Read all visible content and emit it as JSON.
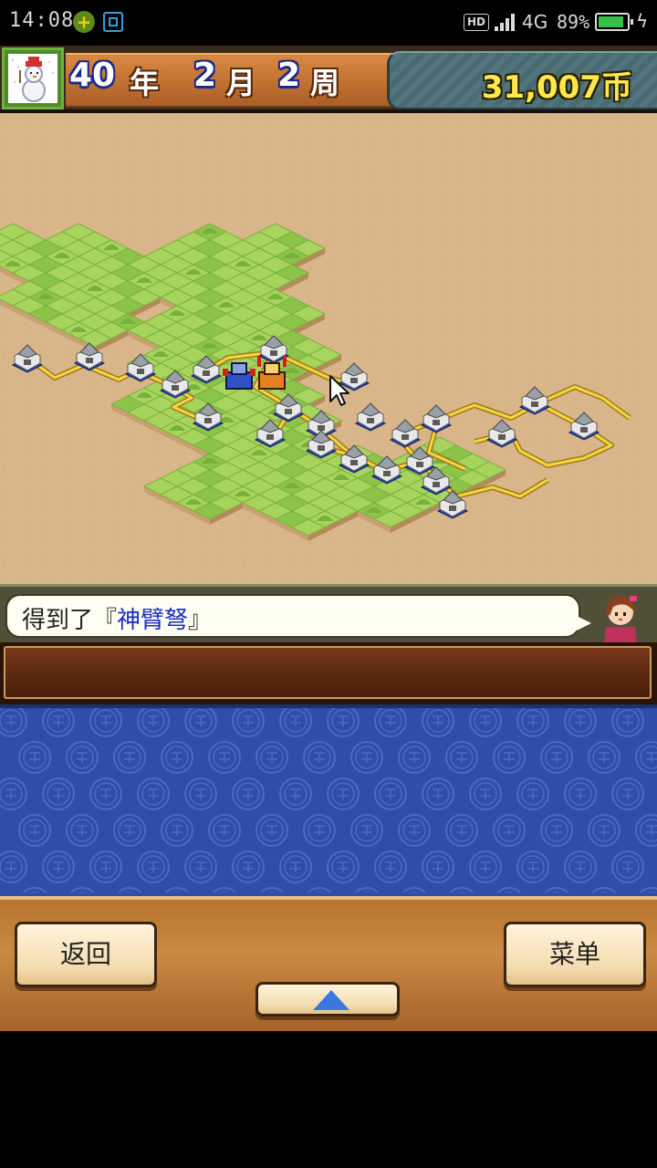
{
  "status_bar": {
    "time": "14:08",
    "hd_label": "HD",
    "network": "4G",
    "battery_percent_text": "89%",
    "battery_level": 0.89
  },
  "hud": {
    "year_value": "40",
    "year_unit": "年",
    "month_value": "2",
    "month_unit": "月",
    "week_value": "2",
    "week_unit": "周",
    "money": "31,007币"
  },
  "dialog": {
    "prefix": "得到了『",
    "item_name": "神臂弩",
    "suffix": "』"
  },
  "controls": {
    "back_label": "返回",
    "menu_label": "菜单"
  },
  "colors": {
    "grass": "#a6d45c",
    "road": "#f2d83a",
    "sand": "#d9b58a",
    "pattern_blue": "#2e4ea8",
    "money_text": "#ffe84a",
    "item_text": "#1a2cc8"
  }
}
